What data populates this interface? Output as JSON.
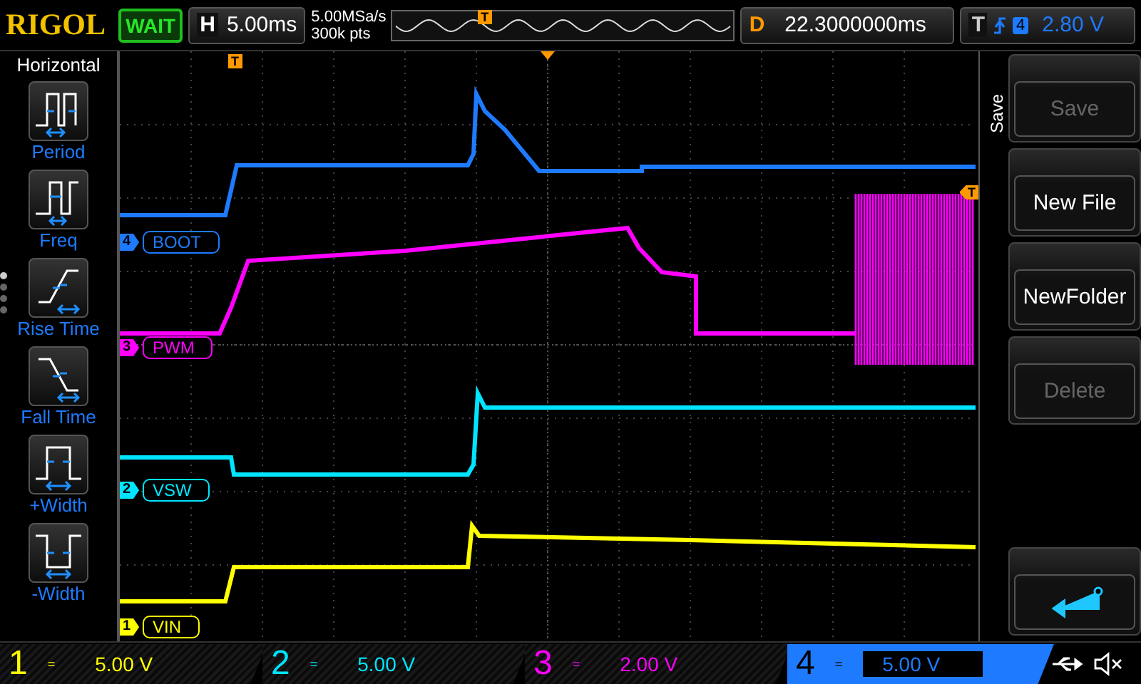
{
  "header": {
    "brand": "RIGOL",
    "status": "WAIT",
    "horizontal": {
      "label": "H",
      "timebase": "5.00ms"
    },
    "sample_rate": "5.00MSa/s",
    "memory_depth": "300k pts",
    "trigger_position": "T",
    "delay": {
      "label": "D",
      "value": "22.3000000ms"
    },
    "trigger": {
      "label": "T",
      "source": "4",
      "level": "2.80 V"
    }
  },
  "sidebar": {
    "title": "Horizontal",
    "pages": [
      {
        "selected": true
      },
      {
        "selected": false
      },
      {
        "selected": false
      },
      {
        "selected": false
      }
    ],
    "items": [
      {
        "label": "Period",
        "kind": "period"
      },
      {
        "label": "Freq",
        "kind": "freq"
      },
      {
        "label": "Rise Time",
        "kind": "rise"
      },
      {
        "label": "Fall Time",
        "kind": "fall"
      },
      {
        "label": "+Width",
        "kind": "pos_width"
      },
      {
        "label": "-Width",
        "kind": "neg_width"
      }
    ]
  },
  "screen": {
    "trigger_marker": "T",
    "level_marker": "T",
    "traces": [
      {
        "number": "4",
        "label": "BOOT",
        "color": "#1e7bff"
      },
      {
        "number": "3",
        "label": "PWM",
        "color": "#ff00ff"
      },
      {
        "number": "2",
        "label": "VSW",
        "color": "#00e5ff"
      },
      {
        "number": "1",
        "label": "VIN",
        "color": "#ffff00"
      }
    ]
  },
  "menu": {
    "title": "Save",
    "buttons": [
      {
        "kind": "text",
        "label": "Save",
        "disabled": true
      },
      {
        "kind": "text",
        "label": "New File",
        "disabled": false
      },
      {
        "kind": "text",
        "label": "NewFolder",
        "disabled": false
      },
      {
        "kind": "text",
        "label": "Delete",
        "disabled": true
      },
      {
        "kind": "back",
        "disabled": false
      }
    ]
  },
  "channels": [
    {
      "number": "1",
      "coupling": "=",
      "scale": "5.00 V",
      "selected": false,
      "color": "#ffff00"
    },
    {
      "number": "2",
      "coupling": "=",
      "scale": "5.00 V",
      "selected": false,
      "color": "#00e5ff"
    },
    {
      "number": "3",
      "coupling": "=",
      "scale": "2.00 V",
      "selected": false,
      "color": "#ff00ff"
    },
    {
      "number": "4",
      "coupling": "=",
      "scale": "5.00 V",
      "selected": true,
      "color": "#1e7bff"
    }
  ]
}
